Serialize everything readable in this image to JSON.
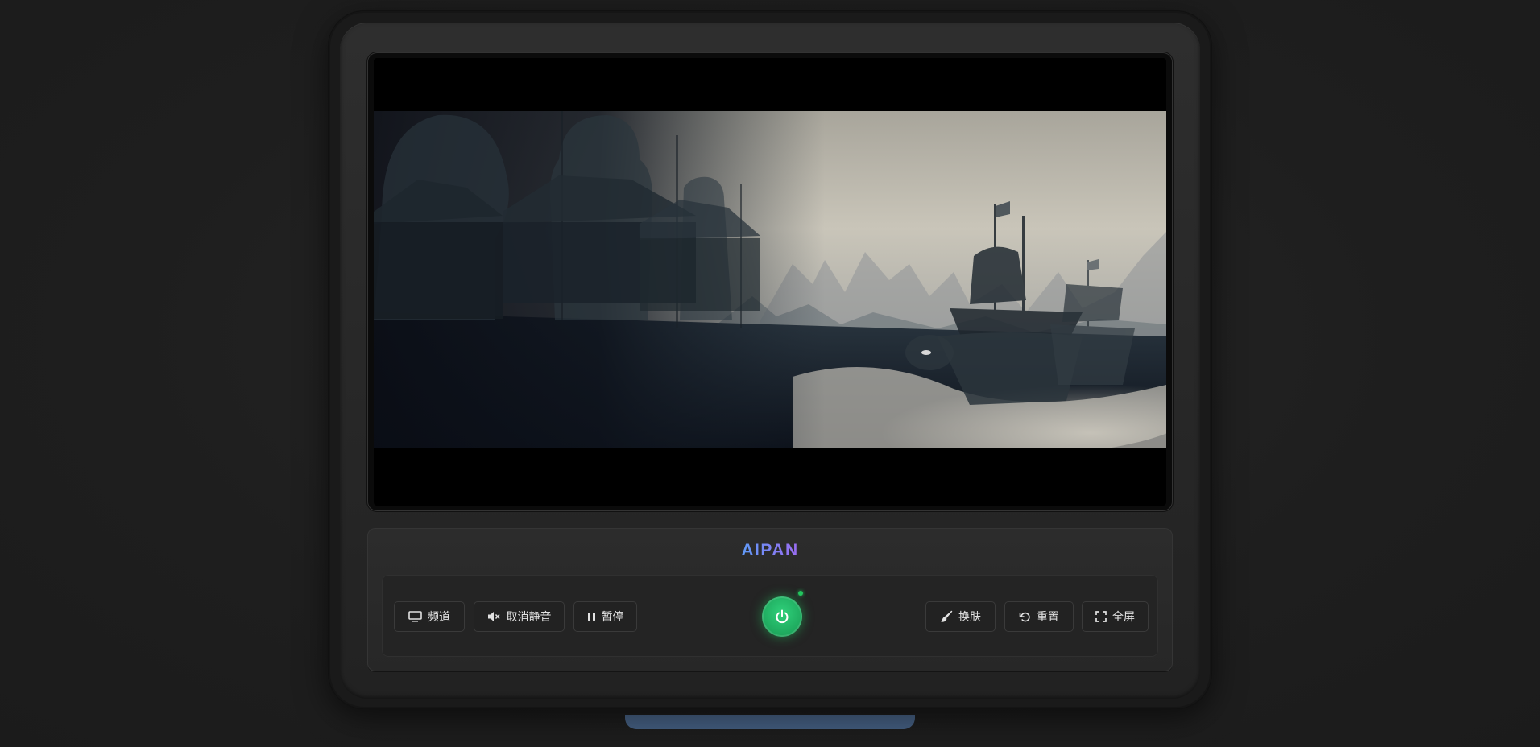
{
  "brand": {
    "name": "AIPAN"
  },
  "controls": {
    "left": [
      {
        "id": "channel",
        "label": "频道",
        "icon": "monitor-icon"
      },
      {
        "id": "unmute",
        "label": "取消静音",
        "icon": "volume-mute-icon"
      },
      {
        "id": "pause",
        "label": "暂停",
        "icon": "pause-icon"
      }
    ],
    "right": [
      {
        "id": "skin",
        "label": "换肤",
        "icon": "brush-icon"
      },
      {
        "id": "reset",
        "label": "重置",
        "icon": "undo-icon"
      },
      {
        "id": "fullscreen",
        "label": "全屏",
        "icon": "fullscreen-icon"
      }
    ],
    "power": {
      "icon": "power-icon",
      "state": "on"
    }
  },
  "colors": {
    "power_on": "#22c55e",
    "brand_gradient_start": "#5f9bf7",
    "brand_gradient_end": "#9b6cf2",
    "stand": "#3c5473"
  }
}
